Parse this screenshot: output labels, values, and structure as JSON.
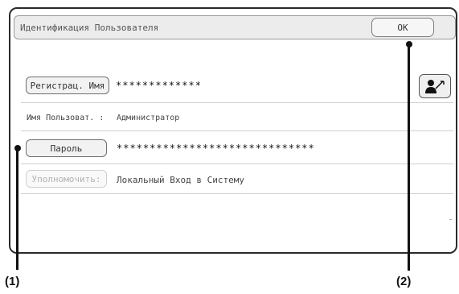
{
  "dialog": {
    "title": "Идентификация Пользователя",
    "ok_label": "OK"
  },
  "login_name": {
    "button_label": "Регистрац. Имя",
    "value": "*************"
  },
  "user_name": {
    "label": "Имя Пользоват. :",
    "value": "Администратор"
  },
  "password": {
    "button_label": "Пароль",
    "value": "******************************"
  },
  "authority": {
    "button_label": "Уполномочить:",
    "value": "Локальный Вход в Систему"
  },
  "login_icon": "user-key-icon",
  "callouts": [
    "(1)",
    "(2)"
  ]
}
